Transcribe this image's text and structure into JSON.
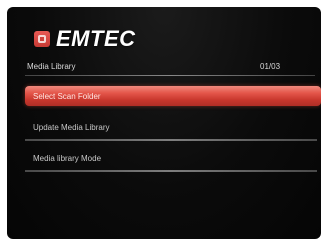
{
  "brand": {
    "logo_text": "EMTEC"
  },
  "header": {
    "title": "Media Library",
    "counter": "01/03"
  },
  "menu": {
    "items": [
      {
        "label": "Select Scan Folder",
        "selected": true
      },
      {
        "label": "Update Media Library",
        "selected": false
      },
      {
        "label": "Media library Mode",
        "selected": false
      }
    ]
  },
  "colors": {
    "accent": "#e4564a",
    "background": "#0b0b0b",
    "text": "#c8c8c8"
  }
}
